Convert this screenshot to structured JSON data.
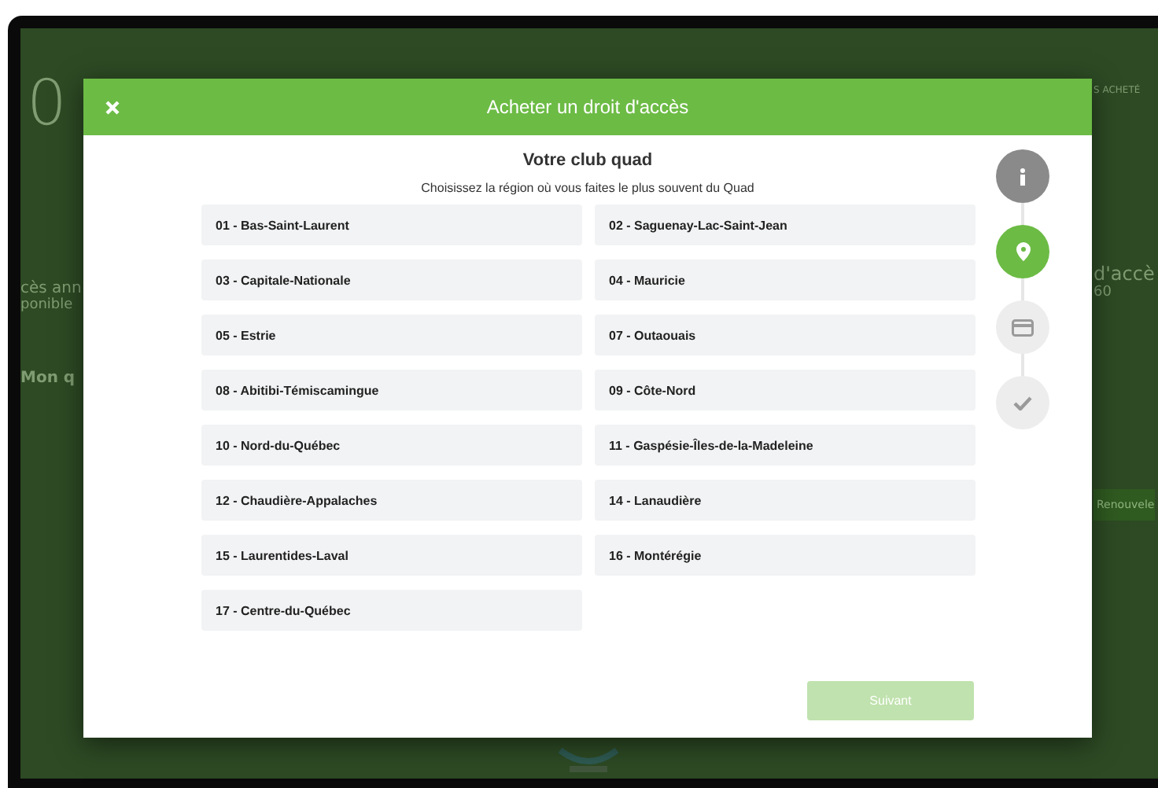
{
  "backdrop": {
    "big_count": "0",
    "left_texts": [
      "cès ann",
      "ponible",
      "Mon q"
    ],
    "right_texts": [
      "S ACHETÉ",
      "d'accè",
      "60"
    ],
    "right_button": "Renouvele"
  },
  "modal": {
    "title": "Acheter un droit d'accès",
    "heading": "Votre club quad",
    "subtitle": "Choisissez la région où vous faites le plus souvent du Quad",
    "regions": [
      {
        "label": "01 - Bas-Saint-Laurent",
        "selected": false
      },
      {
        "label": "02 - Saguenay-Lac-Saint-Jean",
        "selected": false
      },
      {
        "label": "03 - Capitale-Nationale",
        "selected": false
      },
      {
        "label": "04 - Mauricie",
        "selected": false
      },
      {
        "label": "05 - Estrie",
        "selected": false
      },
      {
        "label": "07 - Outaouais",
        "selected": false
      },
      {
        "label": "08 - Abitibi-Témiscamingue",
        "selected": false
      },
      {
        "label": "09 - Côte-Nord",
        "selected": false
      },
      {
        "label": "10 - Nord-du-Québec",
        "selected": false
      },
      {
        "label": "11 - Gaspésie-Îles-de-la-Madeleine",
        "selected": false
      },
      {
        "label": "12 - Chaudière-Appalaches",
        "selected": false
      },
      {
        "label": "14 - Lanaudière",
        "selected": false
      },
      {
        "label": "15 - Laurentides-Laval",
        "selected": false
      },
      {
        "label": "16 - Montérégie",
        "selected": false
      },
      {
        "label": "17 - Centre-du-Québec",
        "selected": false
      }
    ],
    "steps": [
      {
        "kind": "info",
        "completed": true,
        "selected": false
      },
      {
        "kind": "location",
        "completed": false,
        "selected": true
      },
      {
        "kind": "payment",
        "completed": false,
        "selected": false
      },
      {
        "kind": "confirm",
        "completed": false,
        "selected": false
      }
    ],
    "next_button": {
      "label": "Suivant",
      "disabled": true
    }
  }
}
